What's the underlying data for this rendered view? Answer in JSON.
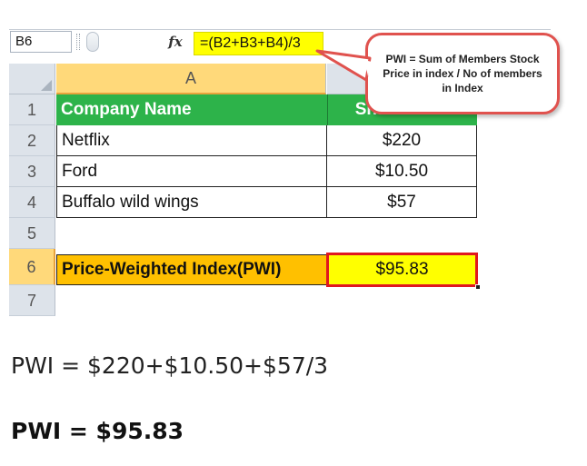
{
  "formula_bar": {
    "name_box": "B6",
    "fx_label": "fx",
    "formula": "=(B2+B3+B4)/3"
  },
  "callout": {
    "text": "PWI = Sum of Members Stock Price in index / No of members in Index"
  },
  "columns": [
    "A"
  ],
  "rows": [
    {
      "num": "1",
      "a": "Company Name",
      "b": "Share Price"
    },
    {
      "num": "2",
      "a": "Netflix",
      "b": "$220"
    },
    {
      "num": "3",
      "a": "Ford",
      "b": "$10.50"
    },
    {
      "num": "4",
      "a": "Buffalo wild wings",
      "b": "$57"
    },
    {
      "num": "5",
      "a": "",
      "b": ""
    },
    {
      "num": "6",
      "a": "Price-Weighted Index(PWI)",
      "b": "$95.83"
    },
    {
      "num": "7",
      "a": "",
      "b": ""
    }
  ],
  "selected_cell": "B6",
  "colors": {
    "header_fill": "#2db34a",
    "pwi_label_fill": "#ffc000",
    "pwi_value_fill": "#ffff00",
    "selection_border": "#e0171f",
    "callout_border": "#e0524e",
    "formula_highlight": "#ffff00"
  },
  "below": {
    "equation": "PWI = $220+$10.50+$57/3",
    "result": "PWI = $95.83"
  }
}
